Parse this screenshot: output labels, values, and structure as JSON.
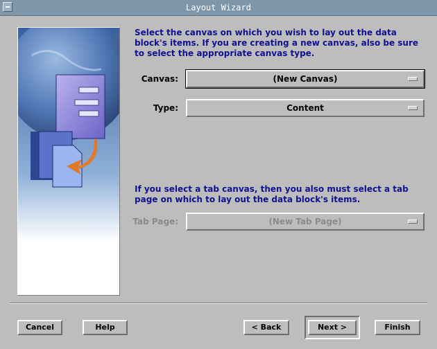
{
  "window": {
    "title": "Layout Wizard"
  },
  "instructions": {
    "canvas_text": "Select the canvas on which you wish to lay out the data block's items. If you are creating a new canvas, also be sure to select the appropriate canvas type.",
    "tab_text": "If you select a tab canvas, then you also must select a tab page on which to lay out the data block's items."
  },
  "fields": {
    "canvas": {
      "label": "Canvas:",
      "value": "(New Canvas)"
    },
    "type": {
      "label": "Type:",
      "value": "Content"
    },
    "tab_page": {
      "label": "Tab Page:",
      "value": "(New Tab Page)",
      "enabled": false
    }
  },
  "buttons": {
    "cancel": "Cancel",
    "help": "Help",
    "back": "< Back",
    "next": "Next >",
    "finish": "Finish"
  },
  "colors": {
    "background": "#bdbdbd",
    "titlebar": "#7d96aa",
    "instruction_text": "#101090"
  }
}
